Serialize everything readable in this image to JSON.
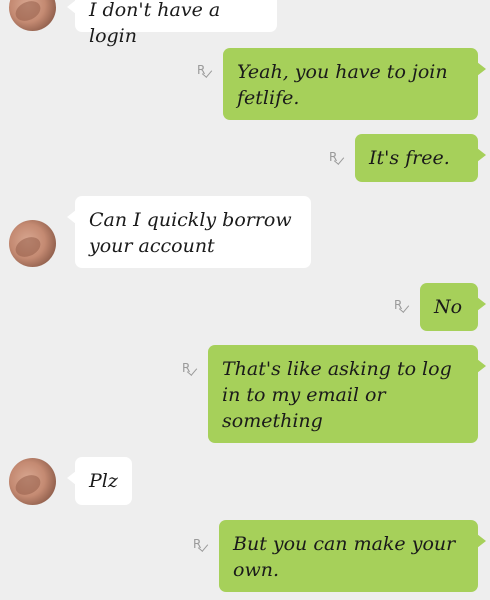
{
  "messages": [
    {
      "direction": "in",
      "text": "I don't have a login"
    },
    {
      "direction": "out",
      "text": "Yeah, you have to join\nfetlife.",
      "receipt": "R"
    },
    {
      "direction": "out",
      "text": "It's free.",
      "receipt": "R"
    },
    {
      "direction": "in",
      "text": "Can I quickly borrow\nyour account"
    },
    {
      "direction": "out",
      "text": "No",
      "receipt": "R"
    },
    {
      "direction": "out",
      "text": "That's like asking to log\nin to my email or\nsomething",
      "receipt": "R"
    },
    {
      "direction": "in",
      "text": "Plz"
    },
    {
      "direction": "out",
      "text": "But you can make your\nown.",
      "receipt": "R"
    }
  ],
  "colors": {
    "incoming": "#ffffff",
    "outgoing": "#a6d05a",
    "background": "#eeeeee"
  },
  "icons": {
    "avatar": "contact-avatar",
    "receipt": "read-receipt-icon"
  }
}
